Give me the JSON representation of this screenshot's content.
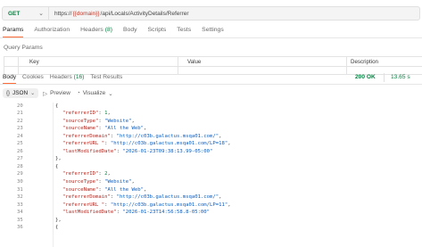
{
  "request": {
    "method": "GET",
    "url_prefix": "https://",
    "url_var": "{{domain}}",
    "url_path": "/api/Locals/ActivityDetails/Referrer"
  },
  "request_tabs": [
    {
      "label": "Params",
      "count": ""
    },
    {
      "label": "Authorization",
      "count": ""
    },
    {
      "label": "Headers",
      "count": "(8)"
    },
    {
      "label": "Body",
      "count": ""
    },
    {
      "label": "Scripts",
      "count": ""
    },
    {
      "label": "Tests",
      "count": ""
    },
    {
      "label": "Settings",
      "count": ""
    }
  ],
  "query_params": {
    "title": "Query Params",
    "columns": [
      "Key",
      "Value",
      "Description"
    ]
  },
  "response_tabs": [
    {
      "label": "Body",
      "count": ""
    },
    {
      "label": "Cookies",
      "count": ""
    },
    {
      "label": "Headers",
      "count": "(16)"
    },
    {
      "label": "Test Results",
      "count": ""
    }
  ],
  "response_status": {
    "status": "200 OK",
    "time": "13.65 s"
  },
  "format_toolbar": {
    "format": "JSON",
    "preview": "Preview",
    "visualize": "Visualize"
  },
  "code_lines": [
    {
      "n": "20",
      "indent": 1,
      "text": "{"
    },
    {
      "n": "21",
      "indent": 2,
      "key": "\"referrerID\"",
      "val": "1",
      "vtype": "num",
      "comma": true
    },
    {
      "n": "22",
      "indent": 2,
      "key": "\"sourceType\"",
      "val": "\"Website\"",
      "vtype": "str",
      "comma": true
    },
    {
      "n": "23",
      "indent": 2,
      "key": "\"sourceName\"",
      "val": "\"All the Web\"",
      "vtype": "str",
      "comma": true
    },
    {
      "n": "24",
      "indent": 2,
      "key": "\"referrerDomain\"",
      "val": "\"http://c03b.galactus.msqa01.com/\"",
      "vtype": "str",
      "comma": true
    },
    {
      "n": "25",
      "indent": 2,
      "key": "\"referrerURL \"",
      "val": "\"http://c03b.galactus.msqa01.com/LP=18\"",
      "vtype": "str",
      "comma": true
    },
    {
      "n": "26",
      "indent": 2,
      "key": "\"lastModifiedDate\"",
      "val": "\"2026-01-23T09:38:13.99-05:00\"",
      "vtype": "str",
      "comma": false
    },
    {
      "n": "27",
      "indent": 1,
      "text": "},"
    },
    {
      "n": "28",
      "indent": 1,
      "text": "{"
    },
    {
      "n": "29",
      "indent": 2,
      "key": "\"referrerID\"",
      "val": "2",
      "vtype": "num",
      "comma": true
    },
    {
      "n": "30",
      "indent": 2,
      "key": "\"sourceType\"",
      "val": "\"Website\"",
      "vtype": "str",
      "comma": true
    },
    {
      "n": "31",
      "indent": 2,
      "key": "\"sourceName\"",
      "val": "\"All the Web\"",
      "vtype": "str",
      "comma": true
    },
    {
      "n": "32",
      "indent": 2,
      "key": "\"referrerDomain\"",
      "val": "\"http://c03b.galactus.msqa01.com/\"",
      "vtype": "str",
      "comma": true
    },
    {
      "n": "33",
      "indent": 2,
      "key": "\"referrerURL \"",
      "val": "\"http://c03b.galactus.msqa01.com/LP=11\"",
      "vtype": "str",
      "comma": true
    },
    {
      "n": "34",
      "indent": 2,
      "key": "\"lastModifiedDate\"",
      "val": "\"2026-01-23T14:56:58.8-05:00\"",
      "vtype": "str",
      "comma": false
    },
    {
      "n": "35",
      "indent": 1,
      "text": "},"
    },
    {
      "n": "36",
      "indent": 1,
      "text": "{"
    }
  ],
  "colors": {
    "accent": "#ff6c37",
    "method_green": "#0b8043",
    "json_key": "#b3261e",
    "json_string": "#0b5ec1"
  }
}
